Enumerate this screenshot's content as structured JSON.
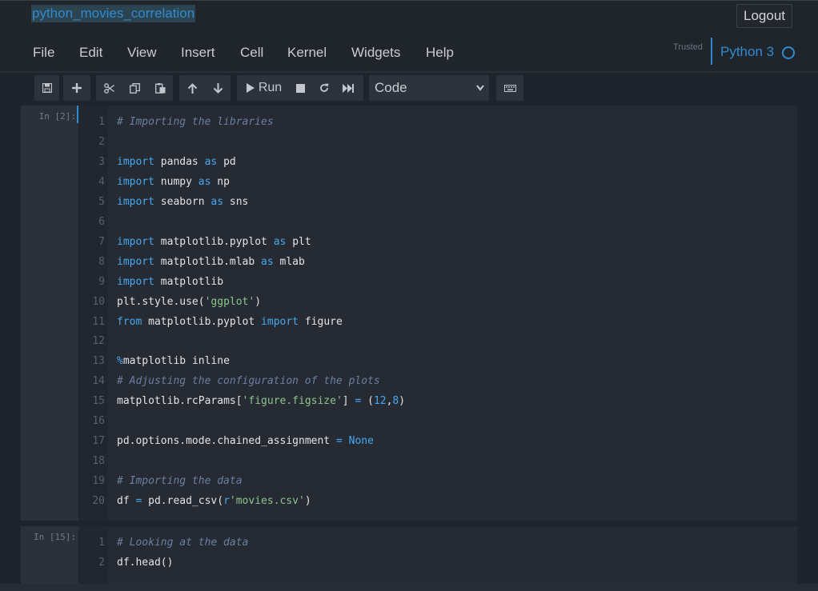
{
  "notebook": {
    "name": "python_movies_correlation",
    "logout_label": "Logout",
    "trusted_label": "Trusted",
    "kernel_name": "Python 3"
  },
  "menu": {
    "items": [
      {
        "label": "File"
      },
      {
        "label": "Edit"
      },
      {
        "label": "View"
      },
      {
        "label": "Insert"
      },
      {
        "label": "Cell"
      },
      {
        "label": "Kernel"
      },
      {
        "label": "Widgets"
      },
      {
        "label": "Help"
      }
    ]
  },
  "toolbar": {
    "run_label": "Run",
    "cell_type_selected": "Code",
    "icons": [
      "save-icon",
      "plus-icon",
      "cut-icon",
      "copy-icon",
      "paste-icon",
      "arrow-up-icon",
      "arrow-down-icon",
      "play-icon",
      "stop-icon",
      "restart-icon",
      "fast-forward-icon",
      "keyboard-icon",
      "chevron-down-icon"
    ]
  },
  "cells": [
    {
      "prompt": "In [2]:",
      "line_numbers": [
        "1",
        "2",
        "3",
        "4",
        "5",
        "6",
        "7",
        "8",
        "9",
        "10",
        "11",
        "12",
        "13",
        "14",
        "15",
        "16",
        "17",
        "18",
        "19",
        "20"
      ],
      "lines": [
        "# Importing the libraries",
        "",
        "import pandas as pd",
        "import numpy as np",
        "import seaborn as sns",
        "",
        "import matplotlib.pyplot as plt",
        "import matplotlib.mlab as mlab",
        "import matplotlib",
        "plt.style.use('ggplot')",
        "from matplotlib.pyplot import figure",
        "",
        "%matplotlib inline",
        "# Adjusting the configuration of the plots",
        "matplotlib.rcParams['figure.figsize'] = (12,8)",
        "",
        "pd.options.mode.chained_assignment = None",
        "",
        "# Importing the data",
        "df = pd.read_csv(r'movies.csv')"
      ]
    },
    {
      "prompt": "In [15]:",
      "line_numbers": [
        "1",
        "2"
      ],
      "lines": [
        "# Looking at the data",
        "df.head()"
      ]
    }
  ],
  "colors": {
    "accent": "#2f8bd1",
    "keyword": "#45a8f2",
    "comment": "#6a7fa3",
    "string": "#8bc58b",
    "background": "#1f232b",
    "cell_background": "#262b33"
  }
}
